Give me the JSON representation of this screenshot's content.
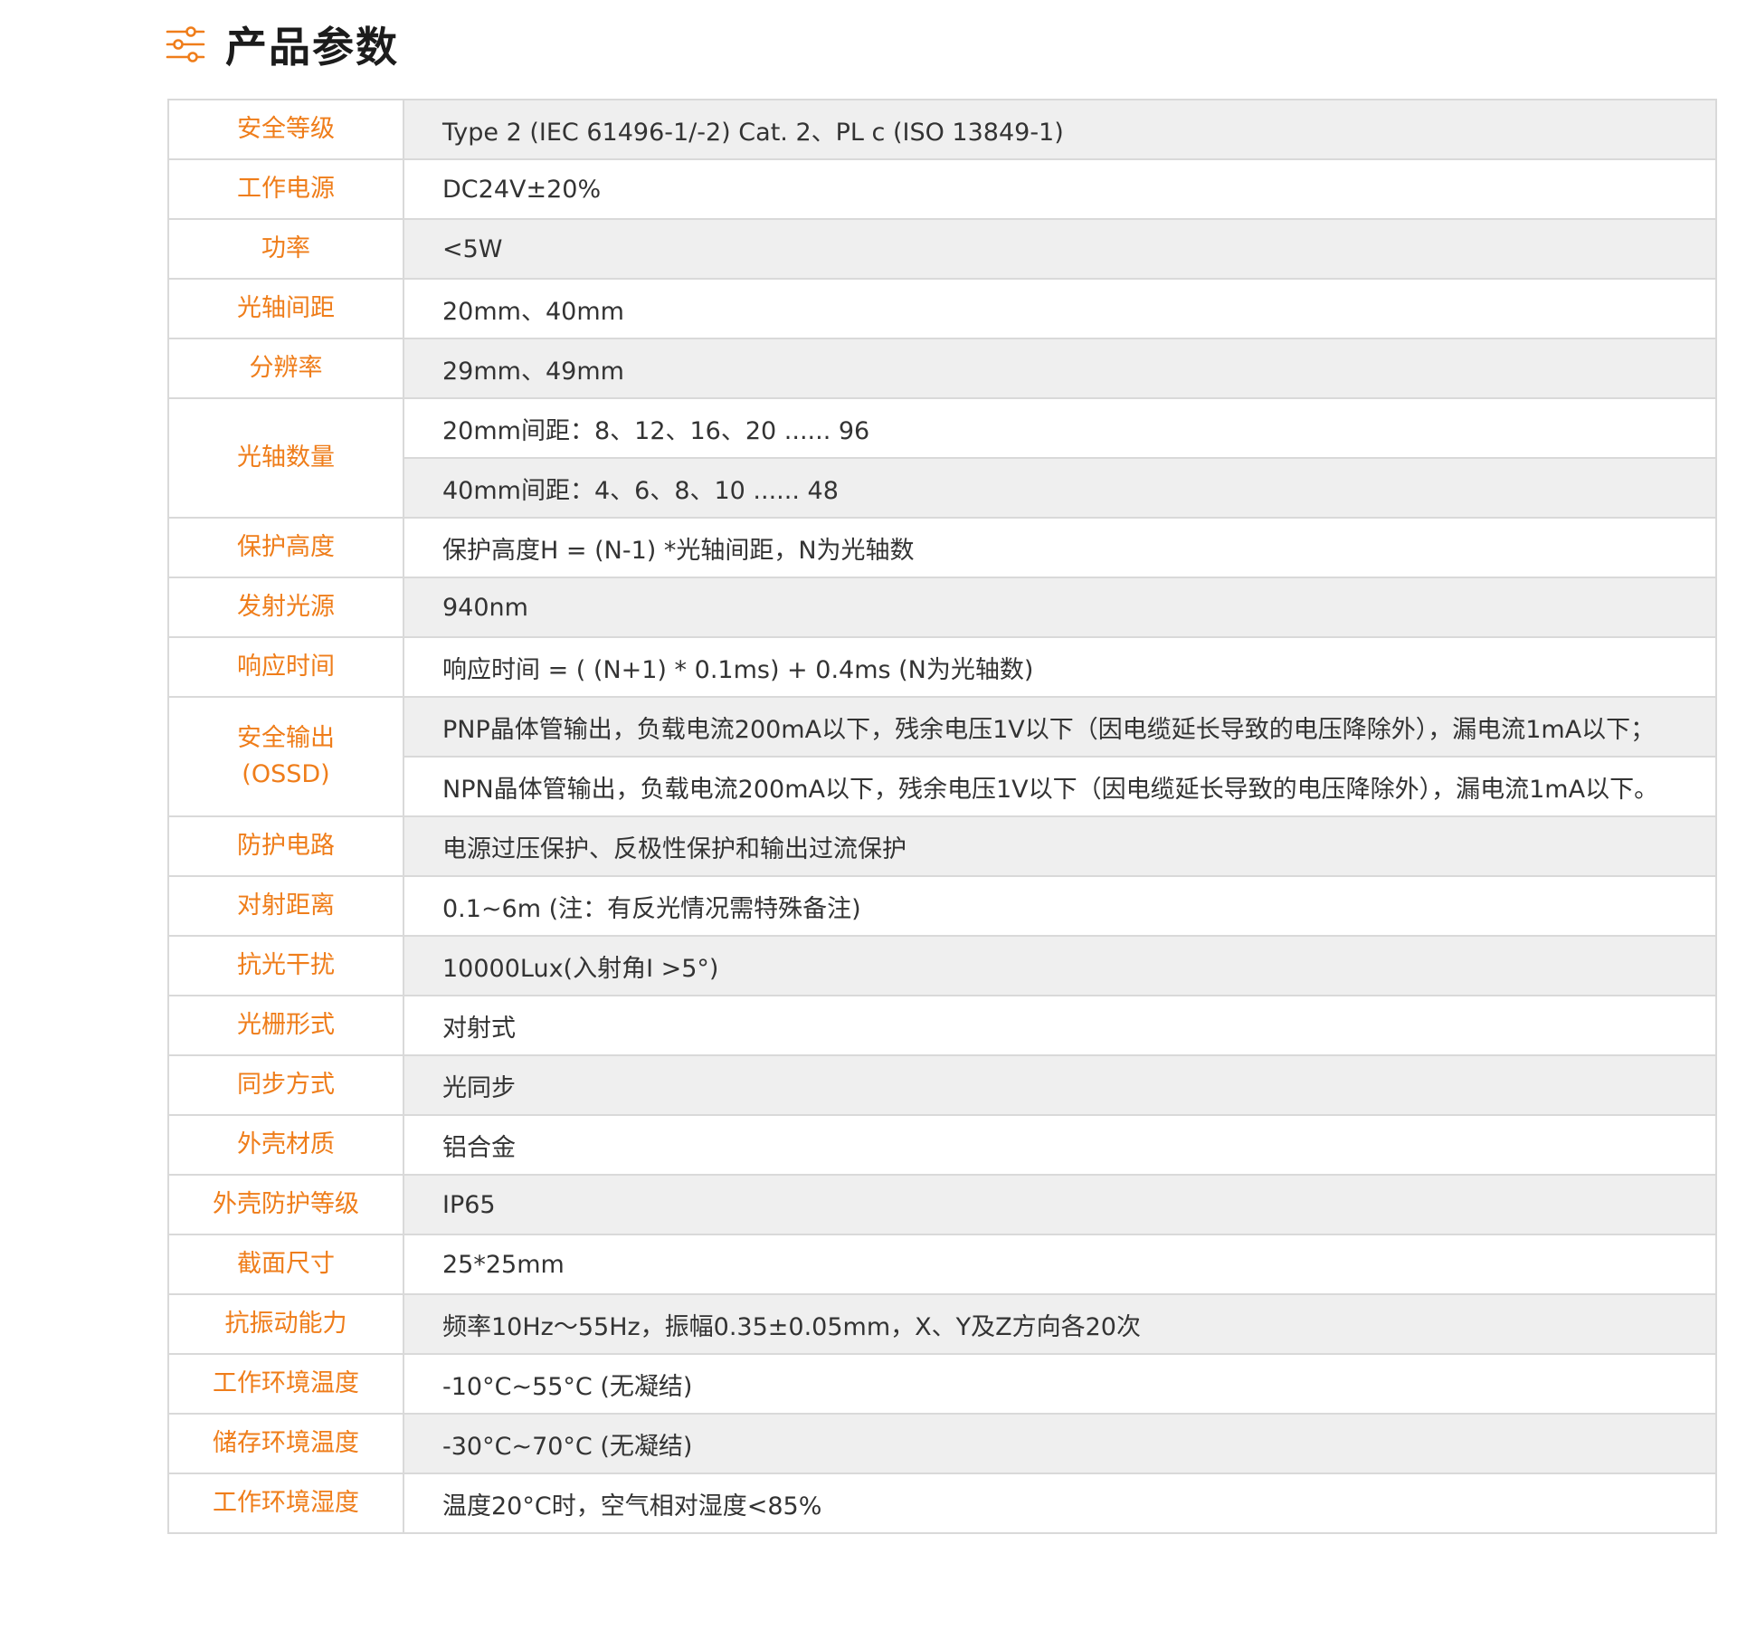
{
  "header": {
    "title": "产品参数",
    "icon": "sliders-icon",
    "accent_color": "#ef7d1a"
  },
  "table": {
    "rows": [
      {
        "label": "安全等级",
        "values": [
          "Type 2 (IEC 61496-1/-2) Cat. 2、PL c (ISO 13849-1)"
        ]
      },
      {
        "label": "工作电源",
        "values": [
          "DC24V±20%"
        ]
      },
      {
        "label": "功率",
        "values": [
          "<5W"
        ]
      },
      {
        "label": "光轴间距",
        "values": [
          "20mm、40mm"
        ]
      },
      {
        "label": "分辨率",
        "values": [
          "29mm、49mm"
        ]
      },
      {
        "label": "光轴数量",
        "values": [
          "20mm间距：8、12、16、20 ...... 96",
          "40mm间距：4、6、8、10 ...... 48"
        ]
      },
      {
        "label": "保护高度",
        "values": [
          "保护高度H = (N-1) *光轴间距，N为光轴数"
        ]
      },
      {
        "label": "发射光源",
        "values": [
          "940nm"
        ]
      },
      {
        "label": "响应时间",
        "values": [
          "响应时间 = ( (N+1) * 0.1ms) + 0.4ms (N为光轴数)"
        ]
      },
      {
        "label": "安全输出",
        "label2": "(OSSD)",
        "values": [
          "PNP晶体管输出，负载电流200mA以下，残余电压1V以下（因电缆延长导致的电压降除外），漏电流1mA以下；",
          "NPN晶体管输出，负载电流200mA以下，残余电压1V以下（因电缆延长导致的电压降除外），漏电流1mA以下。"
        ]
      },
      {
        "label": "防护电路",
        "values": [
          "电源过压保护、反极性保护和输出过流保护"
        ]
      },
      {
        "label": "对射距离",
        "values": [
          "0.1~6m (注：有反光情况需特殊备注)"
        ]
      },
      {
        "label": "抗光干扰",
        "values": [
          "10000Lux(入射角I >5°)"
        ]
      },
      {
        "label": "光栅形式",
        "values": [
          "对射式"
        ]
      },
      {
        "label": "同步方式",
        "values": [
          "光同步"
        ]
      },
      {
        "label": "外壳材质",
        "values": [
          "铝合金"
        ]
      },
      {
        "label": "外壳防护等级",
        "values": [
          "IP65"
        ]
      },
      {
        "label": "截面尺寸",
        "values": [
          "25*25mm"
        ]
      },
      {
        "label": "抗振动能力",
        "values": [
          "频率10Hz～55Hz，振幅0.35±0.05mm，X、Y及Z方向各20次"
        ]
      },
      {
        "label": "工作环境温度",
        "values": [
          "-10°C~55°C (无凝结)"
        ]
      },
      {
        "label": "储存环境温度",
        "values": [
          "-30°C~70°C (无凝结)"
        ]
      },
      {
        "label": "工作环境湿度",
        "values": [
          "温度20°C时，空气相对湿度<85%"
        ]
      }
    ]
  }
}
